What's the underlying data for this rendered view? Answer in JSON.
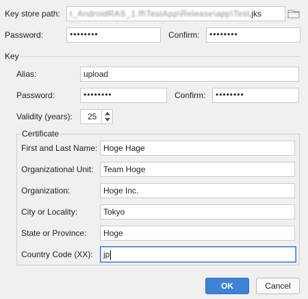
{
  "keystore": {
    "path_label": "Key store path:",
    "path_value_obscured": "t_AndroidRAS_1.ff\\TestApp\\Release\\app\\Test\\app\\Release",
    "path_value_suffix": ".jks",
    "password_label": "Password:",
    "password_value": "••••••••",
    "confirm_label": "Confirm:",
    "confirm_value": "••••••••"
  },
  "key": {
    "section_label": "Key",
    "alias_label": "Alias:",
    "alias_value": "upload",
    "password_label": "Password:",
    "password_value": "••••••••",
    "confirm_label": "Confirm:",
    "confirm_value": "••••••••",
    "validity_label": "Validity (years):",
    "validity_value": "25"
  },
  "certificate": {
    "title": "Certificate",
    "fields": [
      {
        "label": "First and Last Name:",
        "value": "Hoge Hage"
      },
      {
        "label": "Organizational Unit:",
        "value": "Team Hoge"
      },
      {
        "label": "Organization:",
        "value": "Hoge Inc."
      },
      {
        "label": "City or Locality:",
        "value": "Tokyo"
      },
      {
        "label": "State or Province:",
        "value": "Hoge"
      },
      {
        "label": "Country Code (XX):",
        "value": "jp"
      }
    ]
  },
  "buttons": {
    "ok": "OK",
    "cancel": "Cancel"
  },
  "colors": {
    "accent": "#3d82d6",
    "focus_border": "#3a7fd0",
    "background": "#f0f0f0"
  },
  "icons": {
    "folder": "folder-icon",
    "spinner": "spinner-arrows-icon"
  }
}
